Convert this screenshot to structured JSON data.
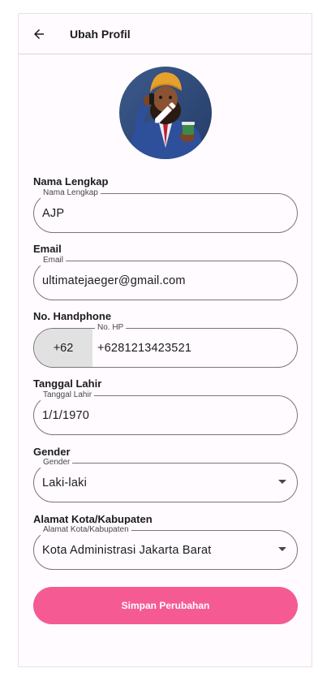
{
  "appbar": {
    "title": "Ubah Profil",
    "back_icon": "arrow-left-icon"
  },
  "avatar": {
    "edit_icon": "pencil-icon"
  },
  "form": {
    "full_name": {
      "section_label": "Nama Lengkap",
      "legend": "Nama Lengkap",
      "value": "AJP"
    },
    "email": {
      "section_label": "Email",
      "legend": "Email",
      "value": "ultimatejaeger@gmail.com"
    },
    "phone": {
      "section_label": "No. Handphone",
      "legend": "No. HP",
      "prefix": "+62",
      "value": "+6281213423521"
    },
    "birth_date": {
      "section_label": "Tanggal Lahir",
      "legend": "Tanggal Lahir",
      "value": "1/1/1970"
    },
    "gender": {
      "section_label": "Gender",
      "legend": "Gender",
      "value": "Laki-laki"
    },
    "city": {
      "section_label": "Alamat Kota/Kabupaten",
      "legend": "Alamat Kota/Kabupaten",
      "value": "Kota Administrasi Jakarta Barat"
    }
  },
  "actions": {
    "save_label": "Simpan Perubahan"
  },
  "colors": {
    "primary": "#f55a93",
    "background": "#fffbfe",
    "outline": "#7a757f",
    "prefix_bg": "#e1e1e1"
  }
}
